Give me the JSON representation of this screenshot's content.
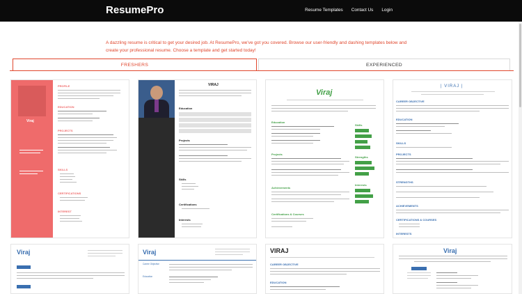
{
  "nav": {
    "brand": "ResumePro",
    "links": [
      "Resume Templates",
      "Contact Us",
      "Login"
    ]
  },
  "intro": {
    "line1": "A dazzling resume is critical to get your desired job. At ResumePro, we've got you covered. Browse our user-friendly and dashing templates below and",
    "line2": "create your professional resume. Choose a template and get started today!"
  },
  "tabs": [
    {
      "label": "FRESHERS",
      "active": true
    },
    {
      "label": "EXPERIENCED",
      "active": false
    }
  ],
  "templates": [
    {
      "name": "Viraj",
      "accent": "#ef6b6b"
    },
    {
      "name": "VIRAJ",
      "accent": "#2b2b2b"
    },
    {
      "name": "Viraj",
      "accent": "#43a047"
    },
    {
      "name": "| VIRAJ |",
      "accent": "#3a6fb0"
    },
    {
      "name": "Viraj",
      "accent": "#3a6fb0"
    },
    {
      "name": "Viraj",
      "accent": "#3a6fb0"
    },
    {
      "name": "VIRAJ",
      "accent": "#222222"
    },
    {
      "name": "Viraj",
      "accent": "#3a6fb0"
    }
  ],
  "colors": {
    "accent": "#e0462c",
    "nav_bg": "#0b0b0b"
  }
}
